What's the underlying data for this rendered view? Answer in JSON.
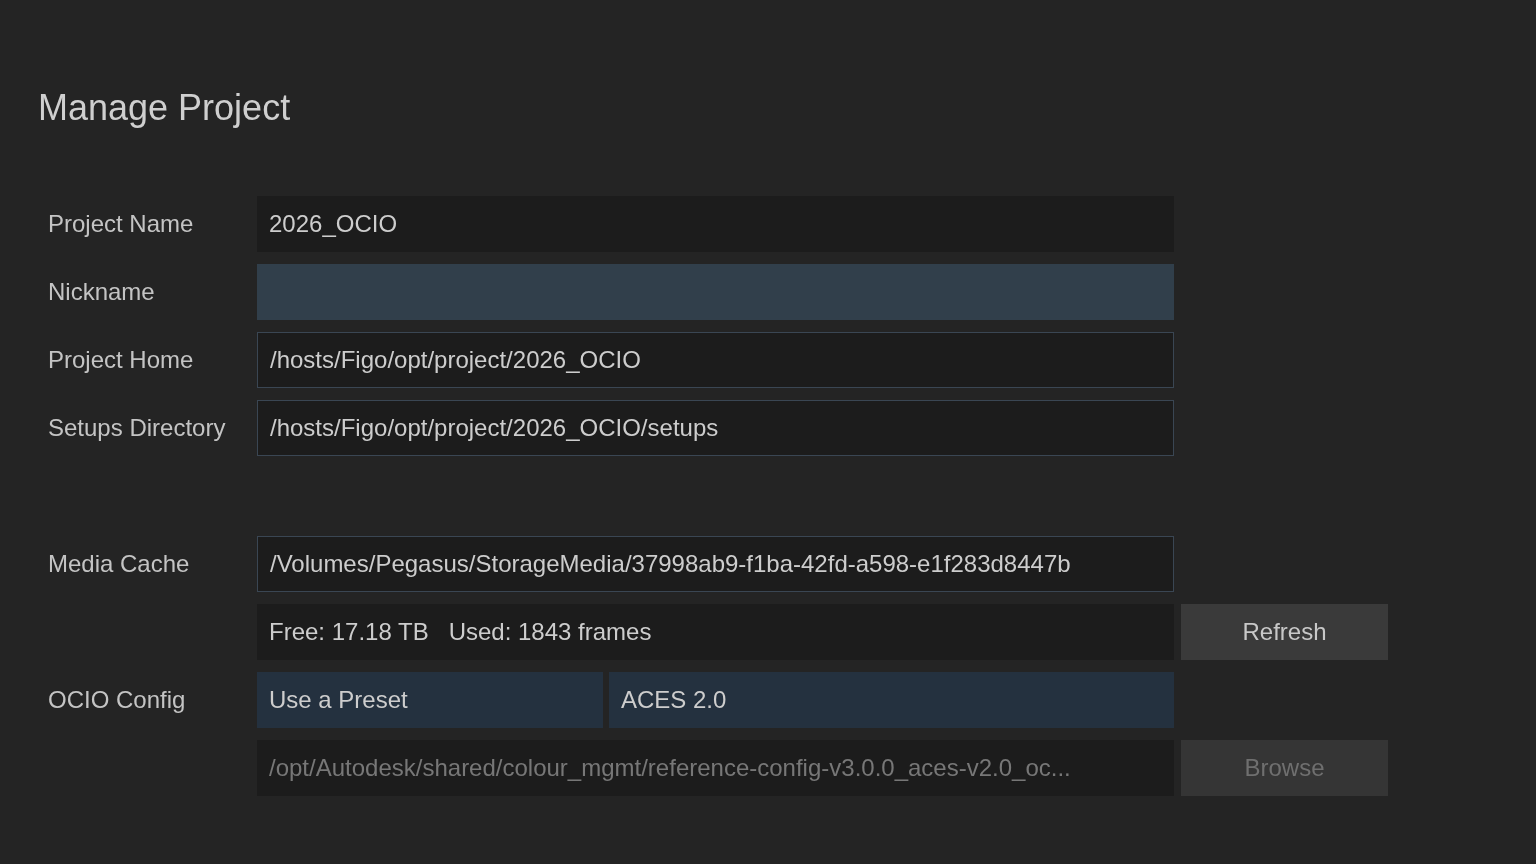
{
  "title": "Manage Project",
  "fields": [
    {
      "label": "Project Name",
      "value": "2026_OCIO",
      "kind": "display"
    },
    {
      "label": "Nickname",
      "kind": "active"
    },
    {
      "label": "Project Home",
      "value": "/hosts/Figo/opt/project/2026_OCIO",
      "kind": "path"
    },
    {
      "label": "Setups Directory",
      "value": "/hosts/Figo/opt/project/2026_OCIO/setups",
      "kind": "path"
    }
  ],
  "media_cache": {
    "label": "Media Cache",
    "path": "/Volumes/Pegasus/StorageMedia/37998ab9-f1ba-42fd-a598-e1f283d8447b",
    "free": "Free: 17.18 TB",
    "used": "Used: 1843 frames",
    "refresh_button": {
      "label": "Refresh",
      "disabled": false
    }
  },
  "ocio_config": {
    "label": "OCIO Config",
    "mode": "Use a Preset",
    "preset": "ACES 2.0",
    "path": "/opt/Autodesk/shared/colour_mgmt/reference-config-v3.0.0_aces-v2.0_oc...",
    "path_disabled": true,
    "browse_button": {
      "label": "Browse",
      "disabled": true
    }
  }
}
